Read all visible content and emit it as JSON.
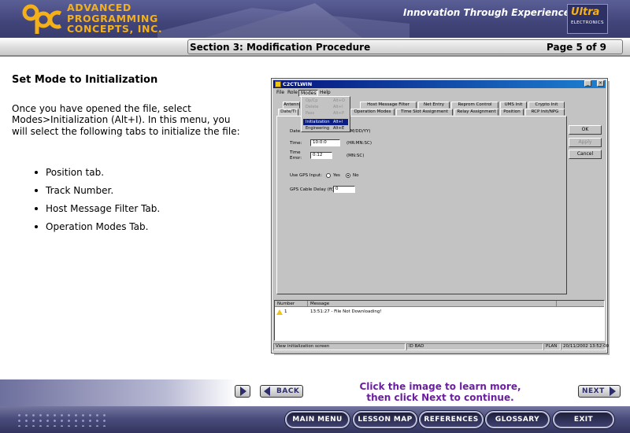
{
  "header": {
    "company_line1": "ADVANCED",
    "company_line2": "PROGRAMMING",
    "company_line3": "CONCEPTS, INC.",
    "tagline": "Innovation Through Experience",
    "partner_logo_word": "Ultra",
    "partner_logo_sub": "ELECTRONICS"
  },
  "titlebar": {
    "section_title": "Section 3: Modification Procedure",
    "page_indicator": "Page 5 of 9"
  },
  "content": {
    "heading": "Set Mode to Initialization",
    "intro": "Once you have opened the file, select Modes>Initialization (Alt+I). In this menu, you will select the following tabs to initialize the file:",
    "bullets": [
      "Position tab.",
      "Track Number.",
      "Host Message Filter Tab.",
      "Operation Modes Tab."
    ]
  },
  "app_screenshot": {
    "window_title": "C2CTLWIN",
    "menus": [
      "File",
      "Role",
      "Modes",
      "Help"
    ],
    "dropdown_items": [
      {
        "label": "Op/Cp",
        "shortcut": "Alt+O"
      },
      {
        "label": "Delete",
        "shortcut": "Alt+l"
      },
      {
        "label": "Pass",
        "shortcut": "Alt+P"
      },
      {
        "label": "Initialization",
        "shortcut": "Alt+I"
      },
      {
        "label": "Engineering",
        "shortcut": "Alt+E"
      }
    ],
    "tabs_row1": [
      "Antenn",
      "Host Message Filter",
      "Net Entry",
      "Reprom Control",
      "UMS Init",
      "Crypto Init"
    ],
    "tabs_row2": [
      "Date/Ti",
      "Operation Modes",
      "Time Slot Assignment",
      "Relay Assignment",
      "Position",
      "RCP Init/NPG"
    ],
    "fields": {
      "date_label": "Date:",
      "date_format": "MM/DD/YY)",
      "time_label": "Time:",
      "time_value": "10:0:0",
      "time_format": "(HR:MN:SC)",
      "time_error_label1": "Time",
      "time_error_label2": "Error:",
      "time_error_value": "0:12",
      "time_error_format": "(MN:SC)",
      "gps_label": "Use GPS Input:",
      "gps_yes": "Yes",
      "gps_no": "No",
      "gps_delay_label": "GPS Cable Delay (ft):",
      "gps_delay_value": "0"
    },
    "buttons": {
      "ok": "OK",
      "apply": "Apply",
      "cancel": "Cancel"
    },
    "log": {
      "col_number": "Number",
      "col_message": "Message",
      "row_number": "1",
      "row_message": "13:51:27 - File Not Downloading!"
    },
    "status": {
      "left": "View initialization screen",
      "id": "ID BAD",
      "mode": "PLAN",
      "datetime": "20/11/2002  13:52:00"
    }
  },
  "navigation": {
    "back_label": "BACK",
    "next_label": "NEXT",
    "message_line1": "Click the image to learn more,",
    "message_line2": "then click Next to continue."
  },
  "footer": {
    "main_menu": "MAIN MENU",
    "lesson_map": "LESSON MAP",
    "references": "REFERENCES",
    "glossary": "GLOSSARY",
    "exit": "EXIT"
  },
  "colors": {
    "header_bg": "#414478",
    "brand_gold": "#f4b019",
    "nav_message": "#6b1fa0",
    "footer_bg": "#4a4c7c"
  }
}
